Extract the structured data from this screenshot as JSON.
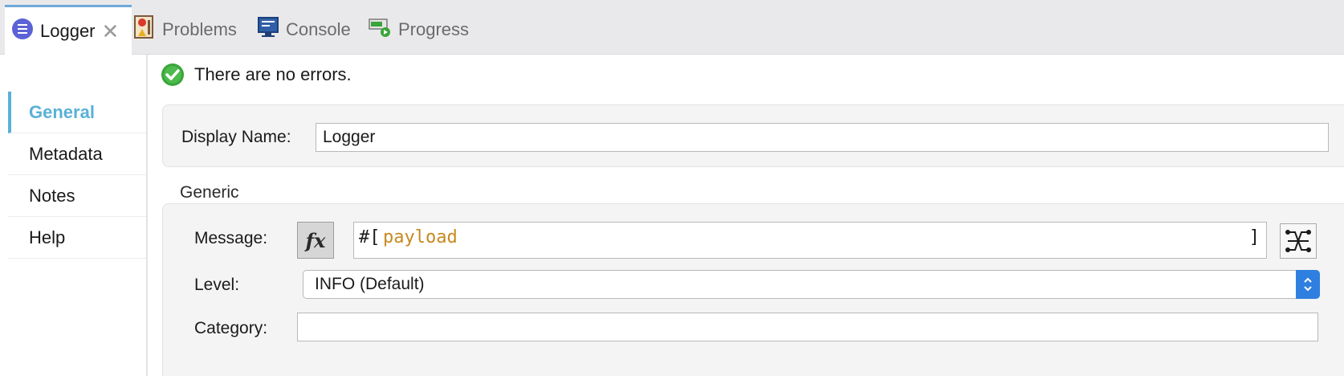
{
  "tabs": [
    {
      "label": "Logger",
      "icon": "logger-icon",
      "active": true
    },
    {
      "label": "Problems",
      "icon": "problems-icon"
    },
    {
      "label": "Console",
      "icon": "console-icon"
    },
    {
      "label": "Progress",
      "icon": "progress-icon"
    }
  ],
  "sidebar": {
    "items": [
      {
        "label": "General",
        "active": true
      },
      {
        "label": "Metadata"
      },
      {
        "label": "Notes"
      },
      {
        "label": "Help"
      }
    ]
  },
  "status": {
    "text": "There are no errors.",
    "icon": "check-circle-icon"
  },
  "display_name": {
    "label": "Display Name:",
    "value": "Logger"
  },
  "generic": {
    "title": "Generic",
    "message": {
      "label": "Message:",
      "fx_label": "fx",
      "open": "#[",
      "expression": "payload",
      "close": "]"
    },
    "level": {
      "label": "Level:",
      "value": "INFO (Default)"
    },
    "category": {
      "label": "Category:",
      "value": ""
    }
  },
  "colors": {
    "accent": "#5ab0d8",
    "expression": "#c8891e",
    "select_arrow": "#2f7fe0",
    "ok": "#3aa53a"
  }
}
